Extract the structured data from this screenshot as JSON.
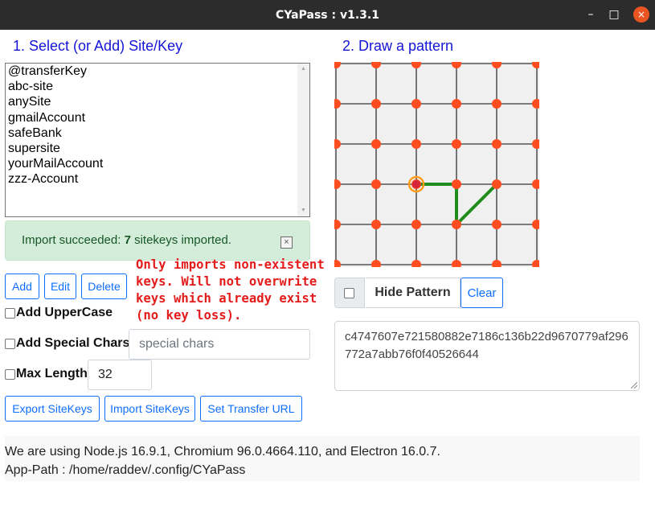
{
  "window": {
    "title": "CYaPass : v1.3.1",
    "controls": {
      "minimize": "–",
      "maximize": "□",
      "close": "×"
    }
  },
  "site_section": {
    "title": "1. Select (or Add) Site/Key",
    "site_keys": [
      "@transferKey",
      "abc-site",
      "anySite",
      "gmailAccount",
      "safeBank",
      "supersite",
      "yourMailAccount",
      "zzz-Account"
    ]
  },
  "alert": {
    "prefix": "Import succeeded: ",
    "count": "7",
    "suffix": " sitekeys imported.",
    "close_glyph": "×"
  },
  "buttons": {
    "add": "Add",
    "edit": "Edit",
    "delete": "Delete",
    "export": "Export SiteKeys",
    "import": "Import SiteKeys",
    "set_transfer": "Set Transfer URL",
    "clear": "Clear"
  },
  "warning_note": "Only imports non-existent keys.  Will not overwrite keys which already exist (no key loss).",
  "options": {
    "add_uppercase": {
      "label": "Add UpperCase",
      "checked": false
    },
    "add_special": {
      "label": "Add Special Chars",
      "checked": false,
      "placeholder": "special chars"
    },
    "max_length": {
      "label": "Max Length",
      "checked": false,
      "value": "32"
    }
  },
  "pattern_section": {
    "title": "2. Draw a pattern",
    "hide_label": "Hide Pattern",
    "hide_checked": false,
    "grid": {
      "rows": 6,
      "cols": 6
    },
    "start_point": [
      2,
      3
    ],
    "path": [
      [
        2,
        3
      ],
      [
        3,
        3
      ],
      [
        3,
        4
      ],
      [
        4,
        3
      ]
    ]
  },
  "password_output": "c4747607e721580882e7186c136b22d9670779af296772a7abb76f0f40526644",
  "footer": {
    "versions": "We are using Node.js 16.9.1, Chromium 96.0.4664.110, and Electron 16.0.7.",
    "app_path": "App-Path : /home/raddev/.config/CYaPass"
  },
  "colors": {
    "section_title": "#1515d6",
    "grid_dot": "#ff4d1f",
    "grid_line": "#555555",
    "grid_bg": "#f0f0f0",
    "path": "#1e8c1e",
    "start_ring": "#ff9c1a",
    "warning": "#e31c1c",
    "alert_bg": "#d4edda",
    "button_blue": "#0d6efd"
  }
}
